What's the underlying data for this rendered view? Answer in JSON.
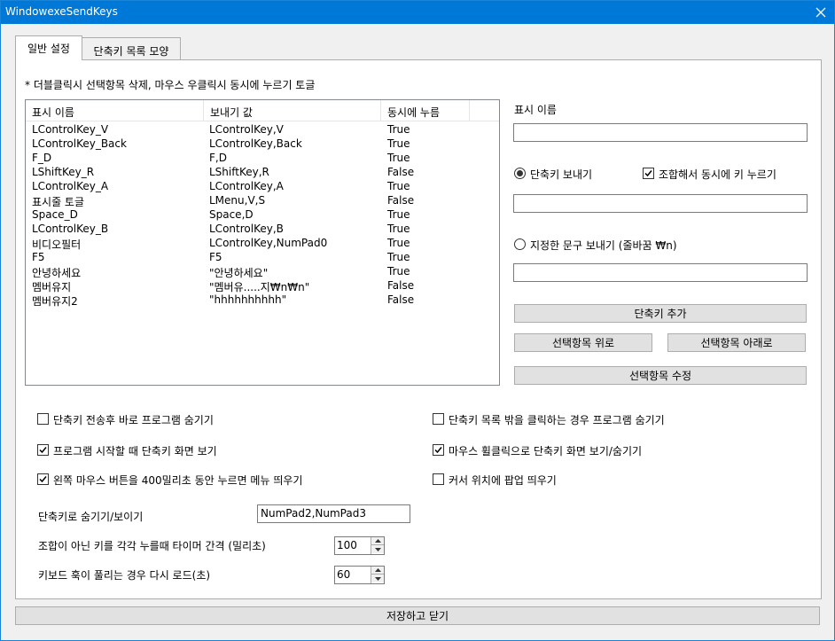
{
  "window": {
    "title": "WindowexeSendKeys"
  },
  "tabs": [
    {
      "label": "일반 설정"
    },
    {
      "label": "단축키 목록 모양"
    }
  ],
  "hint": "* 더블클릭시 선택항목 삭제, 마우스 우클릭시 동시에 누르기 토글",
  "list": {
    "headers": [
      "표시 이름",
      "보내기 값",
      "동시에 누름"
    ],
    "rows": [
      [
        "LControlKey_V",
        "LControlKey,V",
        "True"
      ],
      [
        "LControlKey_Back",
        "LControlKey,Back",
        "True"
      ],
      [
        "F_D",
        "F,D",
        "True"
      ],
      [
        "LShiftKey_R",
        "LShiftKey,R",
        "False"
      ],
      [
        "LControlKey_A",
        "LControlKey,A",
        "True"
      ],
      [
        "표시줄 토글",
        "LMenu,V,S",
        "False"
      ],
      [
        "Space_D",
        "Space,D",
        "True"
      ],
      [
        "LControlKey_B",
        "LControlKey,B",
        "True"
      ],
      [
        "비디오필터",
        "LControlKey,NumPad0",
        "True"
      ],
      [
        "F5",
        "F5",
        "True"
      ],
      [
        "안녕하세요",
        "\"안녕하세요\"",
        "True"
      ],
      [
        "멤버유지",
        "\"멤버유.....지₩n₩n\"",
        "False"
      ],
      [
        "멤버유지2",
        "\"hhhhhhhhhh\"",
        "False"
      ]
    ]
  },
  "right": {
    "display_name_label": "표시 이름",
    "display_name_value": "",
    "send_hotkey_label": "단축키 보내기",
    "combo_label": "조합해서 동시에 키 누르기",
    "hotkey_value": "",
    "send_text_label": "지정한 문구 보내기 (줄바꿈 ₩n)",
    "text_value": "",
    "add_button": "단축키 추가",
    "up_button": "선택항목 위로",
    "down_button": "선택항목 아래로",
    "edit_button": "선택항목 수정"
  },
  "options": {
    "hide_after_send": "단축키 전송후 바로 프로그램 숨기기",
    "hide_on_outside_click": "단축키 목록 밖을 클릭하는 경우 프로그램 숨기기",
    "show_on_start": "프로그램 시작할 때 단축키 화면 보기",
    "wheel_click_toggle": "마우스 휠클릭으로 단축키 화면 보기/숨기기",
    "left_hold_menu": "왼쪽 마우스 버튼을 400밀리초 동안 누르면 메뉴 띄우기",
    "popup_at_cursor": "커서 위치에 팝업 띄우기"
  },
  "settings": {
    "toggle_hotkey_label": "단축키로 숨기기/보이기",
    "toggle_hotkey_value": "NumPad2,NumPad3",
    "timer_label": "조합이 아닌 키를 각각 누를때 타이머 간격 (밀리초)",
    "timer_value": "100",
    "reload_label": "키보드 훅이 풀리는 경우 다시 로드(초)",
    "reload_value": "60"
  },
  "footer": {
    "save_button": "저장하고 닫기"
  }
}
